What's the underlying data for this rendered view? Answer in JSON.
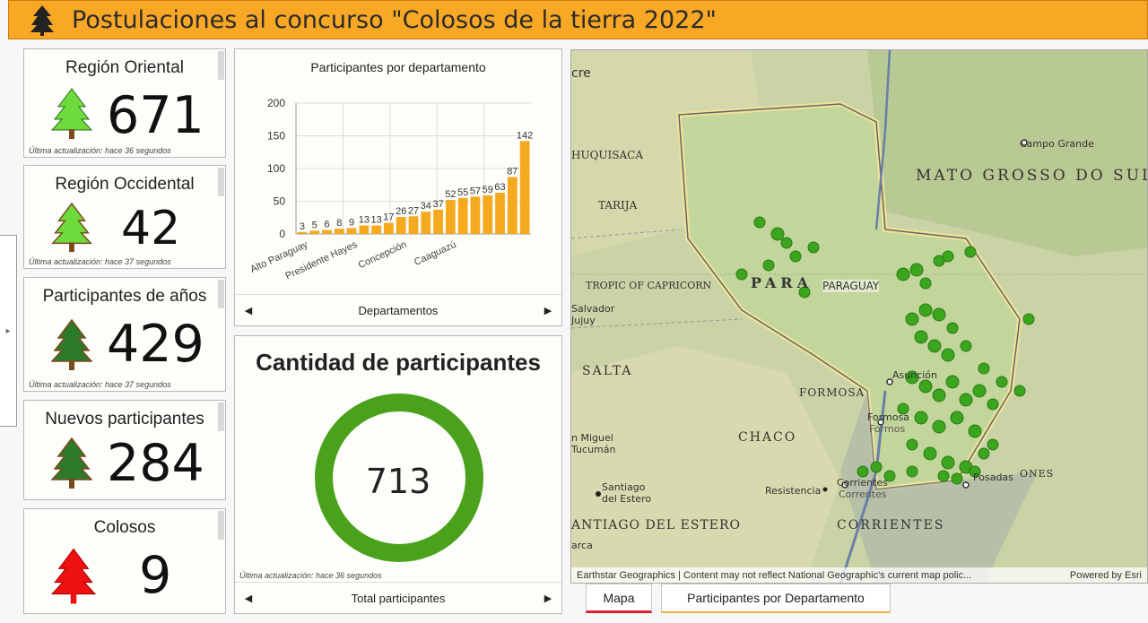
{
  "header": {
    "title": "Postulaciones al concurso \"Colosos de la tierra 2022\"",
    "icon": "tree-icon"
  },
  "cards": [
    {
      "title": "Región Oriental",
      "value": "671",
      "update": "Última actualización: hace 36 segundos",
      "tree_color": "#6edb3c"
    },
    {
      "title": "Región Occidental",
      "value": "42",
      "update": "Última actualización: hace 37 segundos",
      "tree_color": "#6edb3c"
    },
    {
      "title": "Participantes de años",
      "value": "429",
      "update": "Última actualización: hace 37 segundos",
      "tree_color": "#2d7a2a"
    },
    {
      "title": "Nuevos participantes",
      "value": "284",
      "update": "",
      "tree_color": "#2d7a2a"
    },
    {
      "title": "Colosos",
      "value": "9",
      "update": "",
      "tree_color": "#ee1111"
    }
  ],
  "bar_panel": {
    "nav_label": "Departamentos"
  },
  "chart_data": {
    "type": "bar",
    "title": "Participantes por departamento",
    "categories": [
      "Alto Paraguay",
      "",
      "Presidente Hayes",
      "",
      "",
      "",
      "Concepción",
      "",
      "",
      "",
      "",
      "Caaguazú",
      "",
      "",
      "",
      "",
      "",
      ""
    ],
    "values": [
      3,
      5,
      6,
      8,
      9,
      13,
      13,
      17,
      26,
      27,
      34,
      37,
      52,
      55,
      57,
      59,
      63,
      87,
      142
    ],
    "tick_labels": [
      "Alto Paraguay",
      "Presidente Hayes",
      "Concepción",
      "Caaguazú"
    ],
    "yticks": [
      0,
      50,
      100,
      150,
      200
    ],
    "ylim": [
      0,
      200
    ],
    "xlabel": "",
    "ylabel": "",
    "bar_color": "#f5a91e",
    "grid": true
  },
  "total_panel": {
    "title": "Cantidad de participantes",
    "value": "713",
    "update": "Última actualización: hace 36 segundos",
    "nav_label": "Total participantes",
    "ring_color": "#4aa21c"
  },
  "map": {
    "labels": {
      "campo_grande": "Campo Grande",
      "mato_grosso": "MATO GROSSO DO SUL",
      "chuquisaca": "HUQUISACA",
      "tarija": "TARIJA",
      "tropic": "TROPIC OF CAPRICORN",
      "paraguay_big": "PARA",
      "paraguay_small": "PARAGUAY",
      "salvador": "Salvador",
      "jujuy": "Jujuy",
      "salta": "SALTA",
      "formosa_region": "FORMOSA",
      "asuncion": "Asunción",
      "formosa_city": "Formosa",
      "formosa_city2": "Formos",
      "chaco": "CHACO",
      "tucuman1": "n Miguel",
      "tucuman2": "Tucumán",
      "santiago1": "Santiago",
      "santiago2": "del Estero",
      "resistencia": "Resistencia",
      "corrientes1": "Corrientes",
      "corrientes2": "Correntes",
      "posadas": "Posadas",
      "misiones": "ONES",
      "corrientes_region": "CORRIENTES",
      "santiago_region": "ANTIAGO DEL ESTERO",
      "acre": "cre",
      "arca": "arca"
    },
    "attribution": "Earthstar Geographics | Content may not reflect National Geographic's current map polic...",
    "powered": "Powered by Esri"
  },
  "tabs": [
    "Mapa",
    "Participantes por Departamento"
  ]
}
